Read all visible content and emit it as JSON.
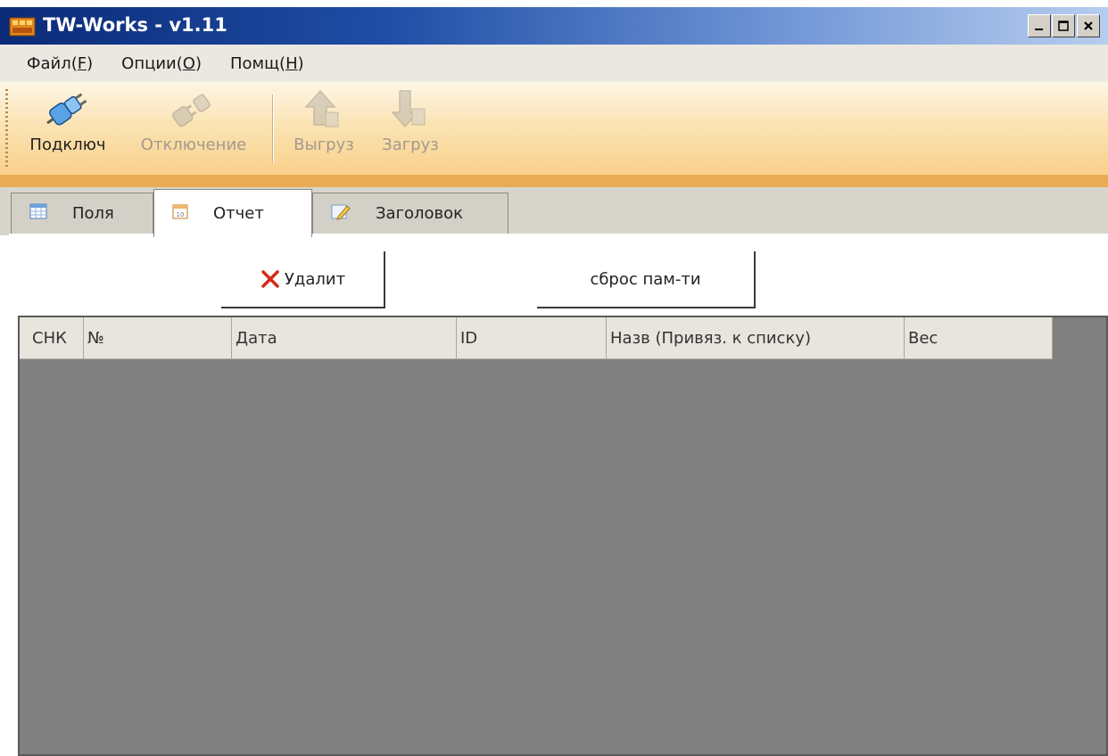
{
  "window": {
    "title": "TW-Works - v1.11"
  },
  "window_controls": {
    "minimize_icon": "minimize-icon",
    "maximize_icon": "maximize-icon",
    "close_icon": "close-icon"
  },
  "menu": {
    "items": [
      {
        "label": "Файл(",
        "mnemonic": "F",
        "close": ")"
      },
      {
        "label": "Опции(",
        "mnemonic": "O",
        "close": ")"
      },
      {
        "label": "Помщ(",
        "mnemonic": "H",
        "close": ")"
      }
    ]
  },
  "toolbar": {
    "buttons": [
      {
        "label": "Подключ",
        "icon": "plug-connect-icon",
        "enabled": true
      },
      {
        "label": "Отключение",
        "icon": "plug-disconnect-icon",
        "enabled": false
      },
      {
        "label": "Выгруз",
        "icon": "upload-arrow-icon",
        "enabled": false
      },
      {
        "label": "Загруз",
        "icon": "download-arrow-icon",
        "enabled": false
      }
    ]
  },
  "tabs": [
    {
      "label": "Поля",
      "icon": "grid-icon",
      "active": false
    },
    {
      "label": "Отчет",
      "icon": "calendar-icon",
      "active": true
    },
    {
      "label": "Заголовок",
      "icon": "edit-icon",
      "active": false
    }
  ],
  "actions": {
    "delete_label": "Удалит",
    "reset_label": "сброс пам-ти"
  },
  "table": {
    "columns": [
      "СНК",
      "№",
      "Дата",
      "ID",
      "Назв (Привяз. к списку)",
      "Вес"
    ],
    "rows": []
  },
  "colors": {
    "titlebar_start": "#0b2a78",
    "toolbar_accent": "#e9ac55",
    "grid_background": "#808080",
    "delete_icon": "#d42a1a"
  }
}
